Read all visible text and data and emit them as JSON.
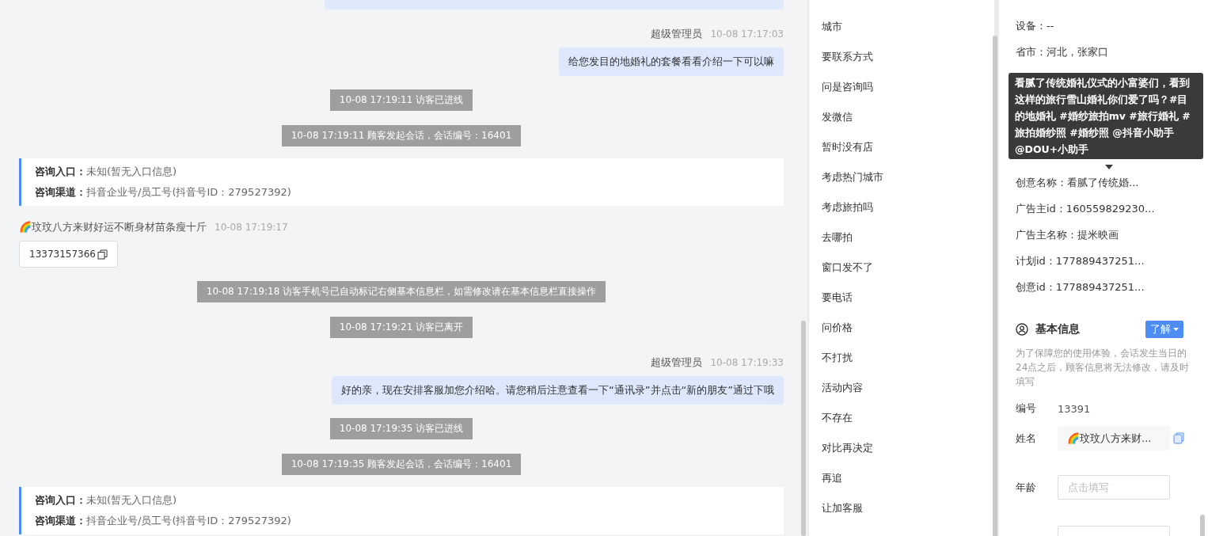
{
  "chat": {
    "messages": [
      {
        "kind": "cut_bubble"
      },
      {
        "kind": "agent",
        "sender": "超级管理员",
        "time": "10-08 17:17:03",
        "text": "给您发目的地婚礼的套餐看看介绍一下可以嘛"
      },
      {
        "kind": "system",
        "text": "10-08 17:19:11 访客已进线"
      },
      {
        "kind": "system",
        "text": "10-08 17:19:11 顾客发起会话，会话编号：16401"
      },
      {
        "kind": "info_card",
        "rows": [
          {
            "label": "咨询入口：",
            "value": "未知(暂无入口信息)"
          },
          {
            "label": "咨询渠道：",
            "value": "抖音企业号/员工号(抖音号ID：279527392)"
          }
        ]
      },
      {
        "kind": "visitor",
        "sender": "🌈玟玟八方来财好运不断身材苗条瘦十斤",
        "time": "10-08 17:19:17",
        "text": "13373157366"
      },
      {
        "kind": "system",
        "text": "10-08 17:19:18 访客手机号已自动标记右侧基本信息栏，如需修改请在基本信息栏直接操作"
      },
      {
        "kind": "system",
        "text": "10-08 17:19:21 访客已离开"
      },
      {
        "kind": "agent",
        "sender": "超级管理员",
        "time": "10-08 17:19:33",
        "text": "好的亲，现在安排客服加您介绍哈。请您稍后注意查看一下“通讯录”并点击“新的朋友”通过下哦"
      },
      {
        "kind": "system",
        "text": "10-08 17:19:35 访客已进线"
      },
      {
        "kind": "system",
        "text": "10-08 17:19:35 顾客发起会话，会话编号：16401"
      },
      {
        "kind": "info_card",
        "rows": [
          {
            "label": "咨询入口：",
            "value": "未知(暂无入口信息)"
          },
          {
            "label": "咨询渠道：",
            "value": "抖音企业号/员工号(抖音号ID：279527392)"
          }
        ]
      }
    ]
  },
  "quick_replies": [
    "城市",
    "要联系方式",
    "问是咨询吗",
    "发微信",
    "暂时没有店",
    "考虑热门城市",
    "考虑旅拍吗",
    "去哪拍",
    "窗口发不了",
    "要电话",
    "问价格",
    "不打扰",
    "活动内容",
    "不存在",
    "对比再决定",
    "再追",
    "让加客服"
  ],
  "visit_info": [
    {
      "kind": "row",
      "text": "设备：--"
    },
    {
      "kind": "row",
      "text": "省市：河北，张家口"
    },
    {
      "kind": "hidden"
    },
    {
      "kind": "hidden"
    },
    {
      "kind": "hidden"
    },
    {
      "kind": "hidden"
    },
    {
      "kind": "row",
      "text": "创意名称：看腻了传统婚..."
    },
    {
      "kind": "row",
      "text": "广告主id：160559829230..."
    },
    {
      "kind": "row",
      "text": "广告主名称：提米映画"
    },
    {
      "kind": "row",
      "text": "计划id：177889437251..."
    },
    {
      "kind": "row",
      "text": "创意id：177889437251..."
    }
  ],
  "tooltip": "看腻了传统婚礼仪式的小富婆们，看到这样的旅行雪山婚礼你们爱了吗？#目的地婚礼 #婚纱旅拍mv #旅行婚礼 #旅拍婚纱照 #婚纱照 @抖音小助手 @DOU+小助手",
  "basic_info": {
    "title": "基本信息",
    "button": "了解",
    "note": "为了保障您的使用体验，会话发生当日的24点之后，顾客信息将无法修改，请及时填写",
    "fields": [
      {
        "kind": "text",
        "label": "编号",
        "value": "13391"
      },
      {
        "kind": "readonly",
        "label": "姓名",
        "value": "🌈玟玟八方来财..."
      },
      {
        "kind": "input",
        "label": "年龄",
        "placeholder": "点击填写"
      },
      {
        "kind": "input_cut"
      }
    ]
  }
}
